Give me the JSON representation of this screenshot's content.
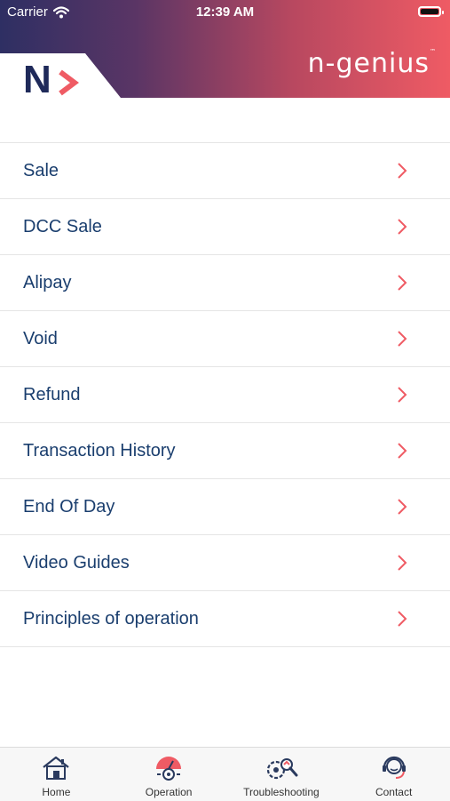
{
  "status_bar": {
    "carrier": "Carrier",
    "time": "12:39 AM"
  },
  "header": {
    "logo_letter": "N",
    "brand_name": "n-genius",
    "brand_tm": "™"
  },
  "menu": {
    "items": [
      {
        "label": "Sale"
      },
      {
        "label": "DCC Sale"
      },
      {
        "label": "Alipay"
      },
      {
        "label": "Void"
      },
      {
        "label": "Refund"
      },
      {
        "label": "Transaction History"
      },
      {
        "label": "End Of Day"
      },
      {
        "label": "Video Guides"
      },
      {
        "label": "Principles of operation"
      }
    ]
  },
  "tab_bar": {
    "items": [
      {
        "label": "Home",
        "icon": "home-icon"
      },
      {
        "label": "Operation",
        "icon": "operation-gear-icon"
      },
      {
        "label": "Troubleshooting",
        "icon": "troubleshooting-icon"
      },
      {
        "label": "Contact",
        "icon": "contact-headset-icon"
      }
    ]
  },
  "colors": {
    "accent": "#ef5b64",
    "navy": "#1f2a5a",
    "label_text": "#1a3e6e"
  }
}
